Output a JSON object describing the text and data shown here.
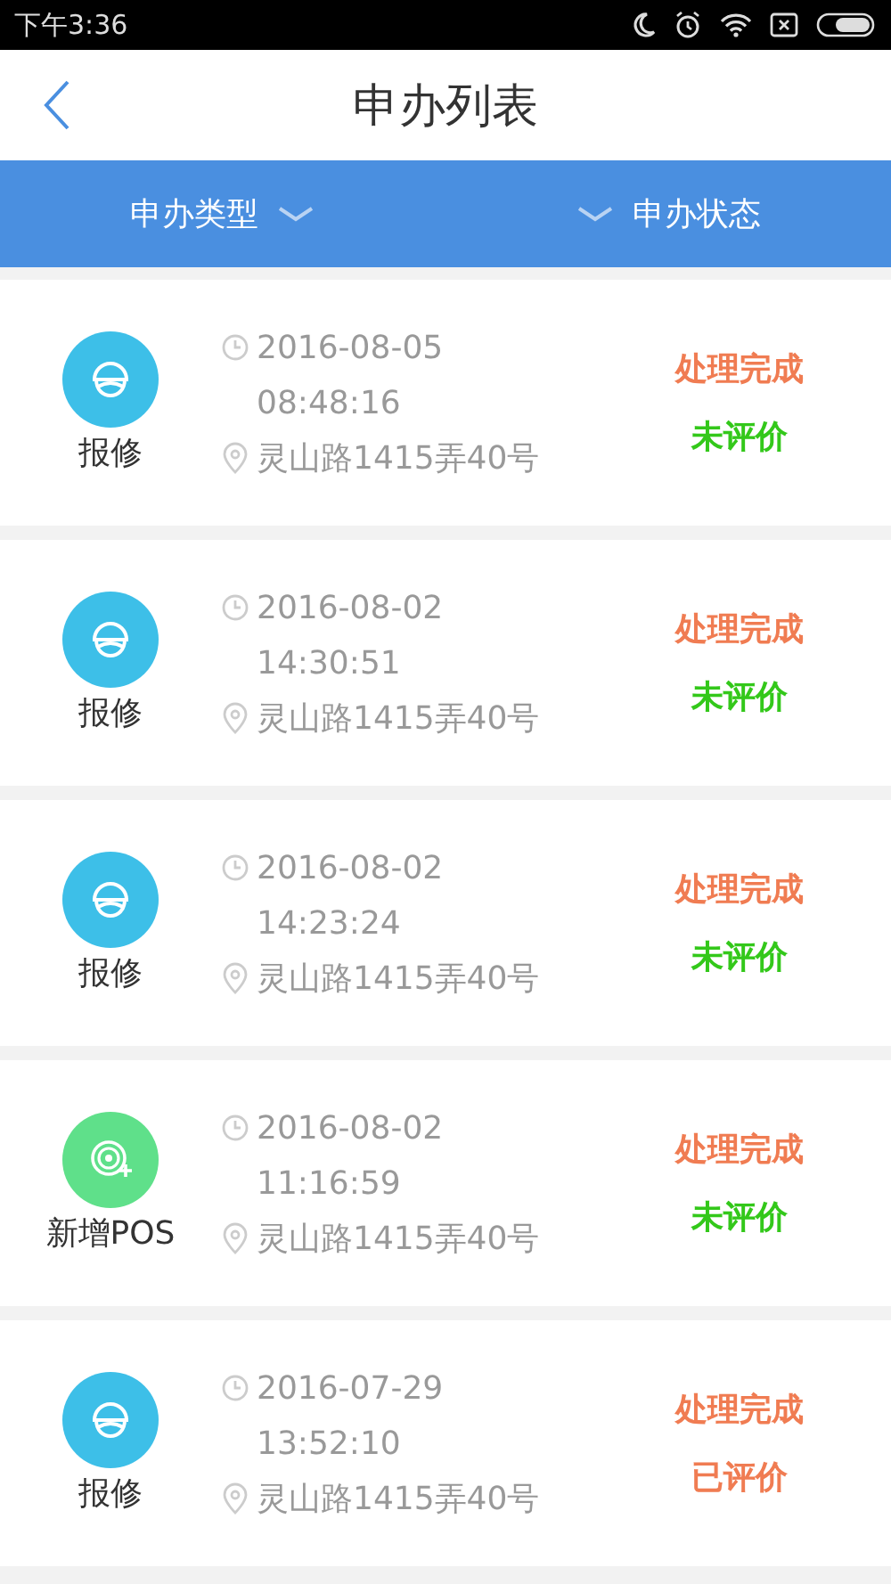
{
  "status_bar": {
    "time": "下午3:36"
  },
  "header": {
    "title": "申办列表"
  },
  "filters": [
    {
      "label": "申办类型",
      "kind": "trailing"
    },
    {
      "label": "申办状态",
      "kind": "leading"
    }
  ],
  "items": [
    {
      "kind": "repair",
      "type": "报修",
      "date": "2016-08-05",
      "time": "08:48:16",
      "address": "灵山路1415弄40号",
      "status": "处理完成",
      "rating": "未评价",
      "rated": false
    },
    {
      "kind": "repair",
      "type": "报修",
      "date": "2016-08-02",
      "time": "14:30:51",
      "address": "灵山路1415弄40号",
      "status": "处理完成",
      "rating": "未评价",
      "rated": false
    },
    {
      "kind": "repair",
      "type": "报修",
      "date": "2016-08-02",
      "time": "14:23:24",
      "address": "灵山路1415弄40号",
      "status": "处理完成",
      "rating": "未评价",
      "rated": false
    },
    {
      "kind": "pos",
      "type": "新增POS",
      "date": "2016-08-02",
      "time": "11:16:59",
      "address": "灵山路1415弄40号",
      "status": "处理完成",
      "rating": "未评价",
      "rated": false
    },
    {
      "kind": "repair",
      "type": "报修",
      "date": "2016-07-29",
      "time": "13:52:10",
      "address": "灵山路1415弄40号",
      "status": "处理完成",
      "rating": "已评价",
      "rated": true
    }
  ]
}
